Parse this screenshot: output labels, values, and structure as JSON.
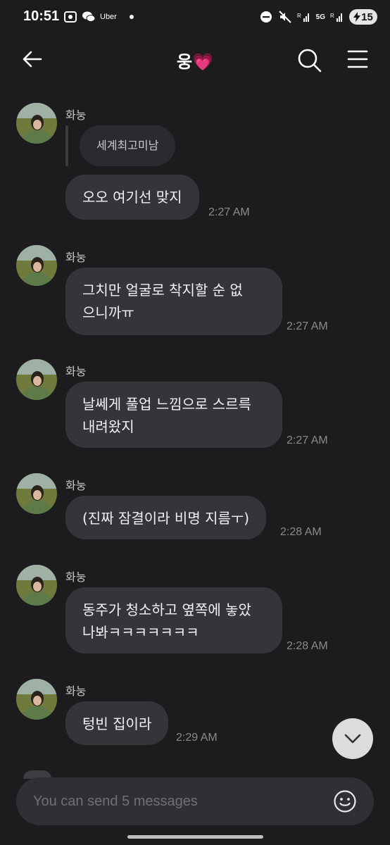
{
  "status_bar": {
    "time": "10:51",
    "app_label": "Uber",
    "network": "5G",
    "battery": "15"
  },
  "header": {
    "title": "웅💗"
  },
  "messages": [
    {
      "sender": "화눙",
      "reply_quote": "세계최고미남",
      "text": "오오 여기선 맞지",
      "time": "2:27 AM"
    },
    {
      "sender": "화눙",
      "text": "그치만 얼굴로 착지할 순 없\n으니까ㅠ",
      "time": "2:27 AM"
    },
    {
      "sender": "화눙",
      "text": "날쎄게 풀업 느낌으로 스르륵\n내려왔지",
      "time": "2:27 AM"
    },
    {
      "sender": "화눙",
      "text": "(진짜 잠결이라 비명 지름ㅜ)",
      "time": "2:28 AM"
    },
    {
      "sender": "화눙",
      "text": "동주가 청소하고 옆쪽에 놓았\n나봐ㅋㅋㅋㅋㅋㅋㅋ",
      "time": "2:28 AM"
    },
    {
      "sender": "화눙",
      "text": "텅빈 집이라",
      "time": "2:29 AM"
    }
  ],
  "input": {
    "placeholder": "You can send 5 messages"
  },
  "colors": {
    "background": "#1c1c1f",
    "bubble": "#34353a",
    "input": "#2f3035",
    "fab": "#dcdcdf"
  },
  "icons": [
    "back-arrow-icon",
    "search-icon",
    "menu-icon",
    "chevron-down-icon",
    "emoji-icon"
  ]
}
